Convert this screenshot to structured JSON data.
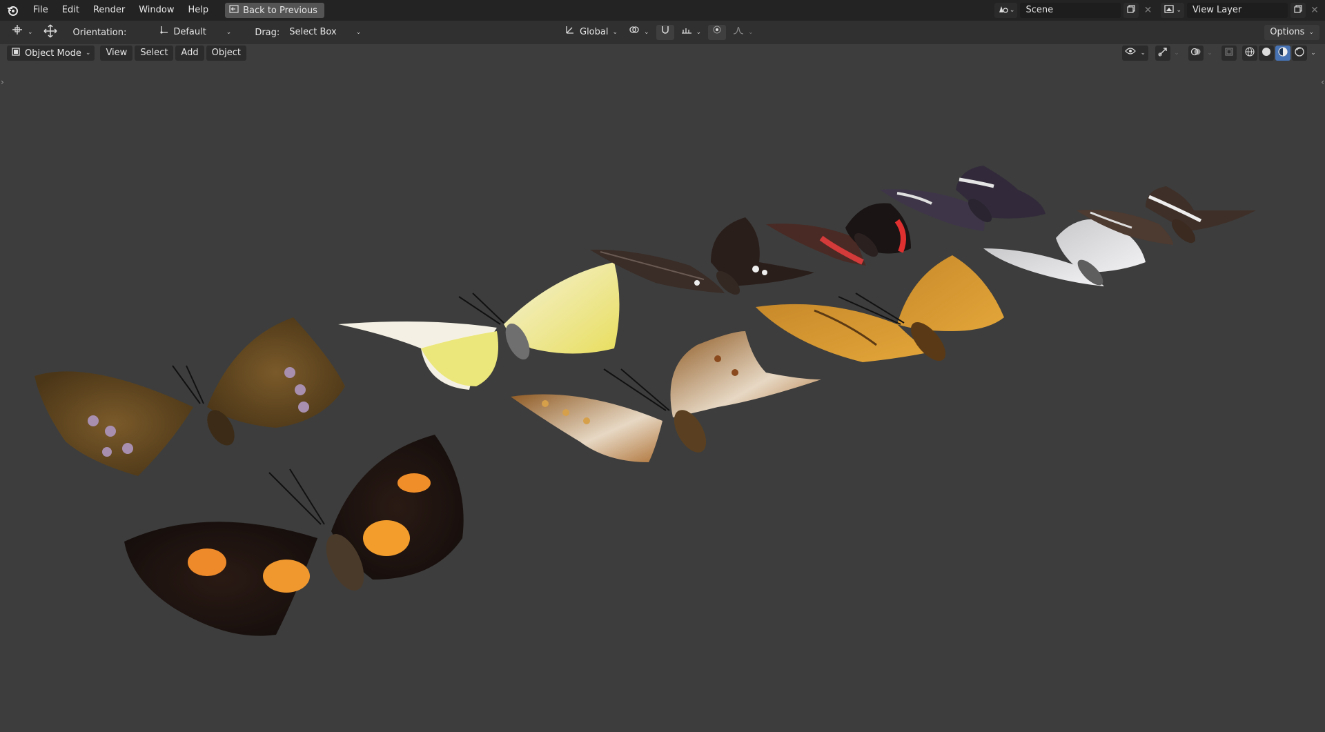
{
  "menu": [
    "File",
    "Edit",
    "Render",
    "Window",
    "Help"
  ],
  "back_button": "Back to Previous",
  "scene_name": "Scene",
  "view_layer_name": "View Layer",
  "toolbar": {
    "orientation_label": "Orientation:",
    "orientation_value": "Default",
    "drag_label": "Drag:",
    "drag_value": "Select Box",
    "transform_orientation": "Global",
    "options_label": "Options"
  },
  "header": {
    "mode": "Object Mode",
    "menus": [
      "View",
      "Select",
      "Add",
      "Object"
    ]
  },
  "colors": {
    "viewport_bg": "#3d3d3d",
    "topbar_bg": "#232323",
    "accent": "#4772b3"
  },
  "icons": [
    "blender-logo-icon",
    "back-icon",
    "scene-icon",
    "view-layer-icon",
    "transform-icon",
    "move-icon",
    "pivot-icon",
    "global-axis-icon",
    "snap-icon",
    "proportional-icon",
    "visibility-icon",
    "gizmo-icon",
    "overlay-icon",
    "xray-icon",
    "wireframe-icon",
    "solid-icon",
    "material-icon",
    "rendered-icon"
  ]
}
